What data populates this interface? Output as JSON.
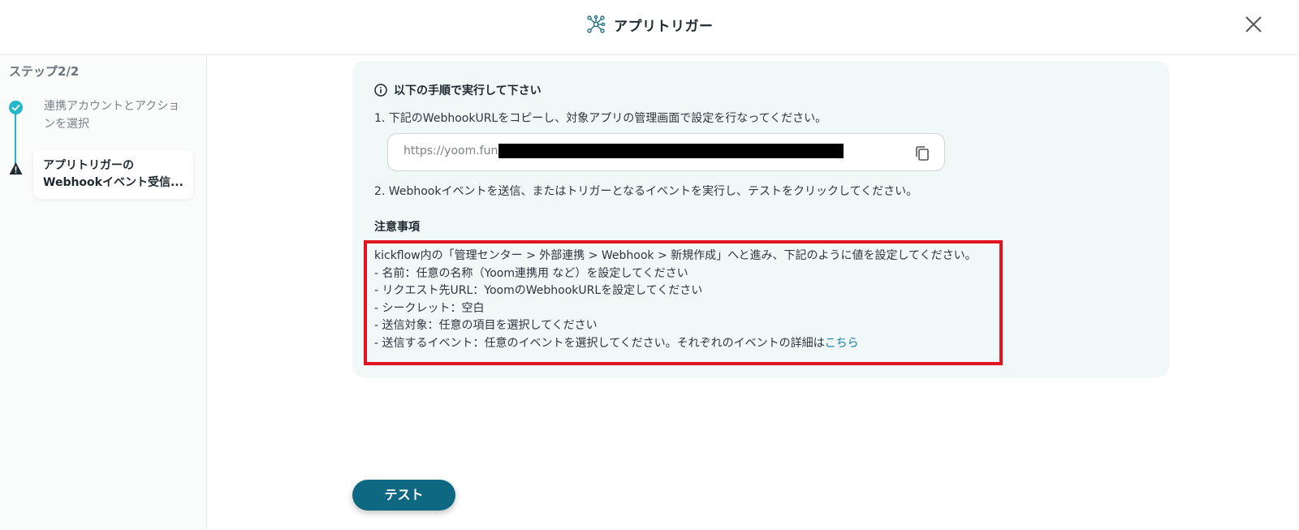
{
  "header": {
    "title": "アプリトリガー",
    "icon": "app-trigger-network-icon",
    "close_icon": "close-icon"
  },
  "sidebar": {
    "step_count": "ステップ2/2",
    "steps": [
      {
        "label": "連携アカウントとアクションを選択",
        "status": "completed",
        "icon": "check-circle-icon"
      },
      {
        "label": "アプリトリガーのWebhookイベント受信...",
        "status": "warning-current",
        "icon": "warning-icon"
      }
    ]
  },
  "main": {
    "instructions_title": "以下の手順で実行して下さい",
    "step1": "1. 下記のWebhookURLをコピーし、対象アプリの管理画面で設定を行なってください。",
    "webhook_url_prefix": "https://yoom.fun/",
    "step2": "2. Webhookイベントを送信、またはトリガーとなるイベントを実行し、テストをクリックしてください。",
    "notes_heading": "注意事項",
    "notes": [
      "kickflow内の「管理センター > 外部連携 > Webhook > 新規作成」へと進み、下記のように値を設定してください。",
      "- 名前：任意の名称（Yoom連携用 など）を設定してください",
      "- リクエスト先URL：YoomのWebhookURLを設定してください",
      "- シークレット：空白",
      "- 送信対象：任意の項目を選択してください"
    ],
    "notes_last_line": "- 送信するイベント：任意のイベントを選択してください。それぞれのイベントの詳細は",
    "notes_link": "こちら",
    "test_button": "テスト"
  },
  "colors": {
    "accent": "#0f6882",
    "step_complete": "#24b7c8",
    "highlight_border": "#e0141e",
    "panel_bg": "#f1f8f8",
    "link": "#1a7fa8"
  }
}
